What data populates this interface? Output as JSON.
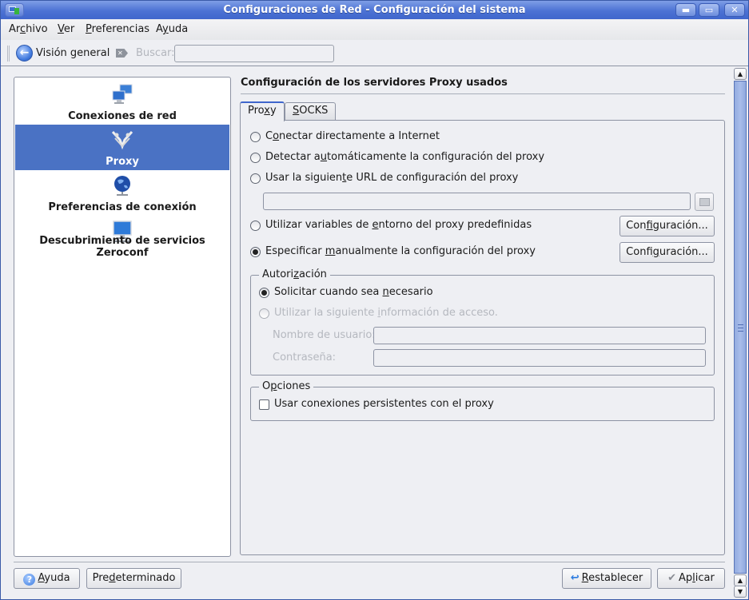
{
  "window": {
    "title": "Configuraciones de Red - Configuración del sistema",
    "controls": {
      "minimize": "minimize-icon",
      "maximize": "maximize-icon",
      "close": "close-icon"
    }
  },
  "menubar": {
    "items": [
      {
        "label": "Archivo",
        "mnemonic_index": 2
      },
      {
        "label": "Ver",
        "mnemonic_index": 0
      },
      {
        "label": "Preferencias",
        "mnemonic_index": 0
      },
      {
        "label": "Ayuda",
        "mnemonic_index": 1
      }
    ]
  },
  "toolbar": {
    "overview_label": "Visión general",
    "search_label": "Buscar:",
    "search_value": "",
    "search_placeholder": ""
  },
  "sidebar": {
    "items": [
      {
        "label": "Conexiones de red",
        "icon": "network-computers-icon",
        "selected": false
      },
      {
        "label": "Proxy",
        "icon": "proxy-icon",
        "selected": true
      },
      {
        "label": "Preferencias de conexión",
        "icon": "globe-network-icon",
        "selected": false
      },
      {
        "label": "Descubrimiento de servicios Zeroconf",
        "icon": "monitor-network-icon",
        "selected": false
      }
    ]
  },
  "main": {
    "heading": "Configuración de los servidores Proxy usados",
    "tabs": [
      {
        "label_pre": "Pro",
        "label_u": "x",
        "label_post": "y",
        "active": true
      },
      {
        "label_pre": "",
        "label_u": "S",
        "label_post": "OCKS",
        "active": false
      }
    ],
    "options": [
      {
        "pre": "C",
        "u": "o",
        "post": "nectar directamente a Internet",
        "checked": false
      },
      {
        "pre": "Detectar a",
        "u": "u",
        "post": "tomáticamente la configuración del proxy",
        "checked": false
      },
      {
        "pre": "Usar la siguien",
        "u": "t",
        "post": "e URL de configuración del proxy",
        "checked": false
      },
      {
        "pre": "Utilizar variables de ",
        "u": "e",
        "post": "ntorno del proxy predefinidas",
        "checked": false
      },
      {
        "pre": "Especificar ",
        "u": "m",
        "post": "anualmente la configuración del proxy",
        "checked": true
      }
    ],
    "url_field_value": "",
    "config_button_1": {
      "pre": "Con",
      "u": "f",
      "post": "iguración..."
    },
    "config_button_2": {
      "pre": "Confi",
      "u": "g",
      "post": "uración..."
    },
    "auth": {
      "title_pre": "Autori",
      "title_u": "z",
      "title_post": "ación",
      "option_prompt": {
        "pre": "Solicitar cuando sea ",
        "u": "n",
        "post": "ecesario",
        "checked": true
      },
      "option_use": {
        "pre": "Utilizar la siguiente ",
        "u": "i",
        "post": "nformación de acceso.",
        "checked": false,
        "disabled": true
      },
      "username_label": "Nombre de usuario:",
      "username_value": "",
      "password_label": "Contraseña:",
      "password_value": ""
    },
    "options_group": {
      "title_pre": "O",
      "title_u": "p",
      "title_post": "ciones",
      "persistent_label": "Usar conexiones persistentes con el proxy",
      "persistent_checked": false
    }
  },
  "footer": {
    "help": {
      "pre": "",
      "u": "A",
      "post": "yuda"
    },
    "defaults": {
      "pre": "Pre",
      "u": "d",
      "post": "eterminado"
    },
    "reset": {
      "pre": "",
      "u": "R",
      "post": "establecer"
    },
    "apply": {
      "pre": "Ap",
      "u": "l",
      "post": "icar"
    }
  },
  "colors": {
    "titlebar": "#4c72d4",
    "selection": "#4a72c4",
    "background": "#eeeff3"
  }
}
